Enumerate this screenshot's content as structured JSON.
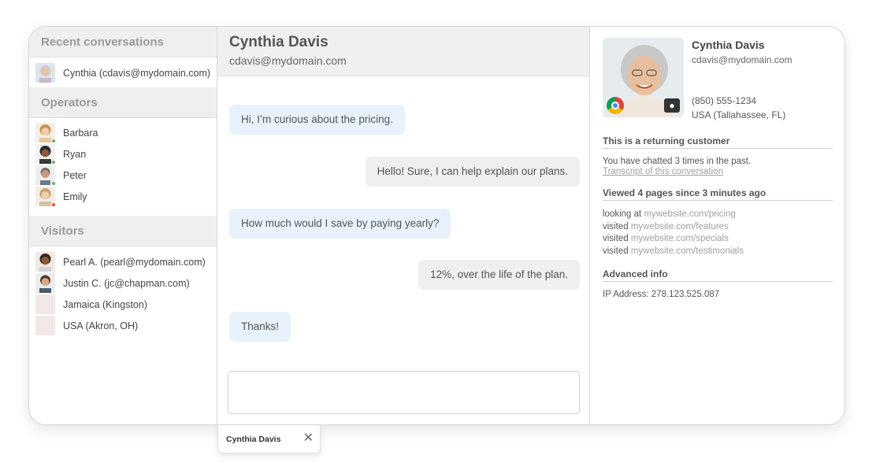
{
  "recent": {
    "header": "Recent conversations",
    "items": [
      {
        "label": "Cynthia (cdavis@mydomain.com)"
      }
    ]
  },
  "operators": {
    "header": "Operators",
    "items": [
      {
        "label": "Barbara",
        "status_color": "#5cb85c"
      },
      {
        "label": "Ryan",
        "status_color": "#5cb85c"
      },
      {
        "label": "Peter",
        "status_color": "#5cb85c"
      },
      {
        "label": "Emily",
        "status_color": "#e74c3c"
      }
    ]
  },
  "visitors": {
    "header": "Visitors",
    "items": [
      {
        "label": "Pearl A. (pearl@mydomain.com)"
      },
      {
        "label": "Justin C. (jc@chapman.com)"
      },
      {
        "label": "Jamaica (Kingston)"
      },
      {
        "label": "USA (Akron, OH)"
      }
    ]
  },
  "chat": {
    "name": "Cynthia Davis",
    "email": "cdavis@mydomain.com",
    "messages": [
      {
        "text": "Hi, I’m curious about the pricing.",
        "direction": "in"
      },
      {
        "text": "Hello! Sure, I can help explain our plans.",
        "direction": "out"
      },
      {
        "text": "How much would I save by paying yearly?",
        "direction": "in"
      },
      {
        "text": "12%, over the life of the plan.",
        "direction": "out"
      },
      {
        "text": "Thanks!",
        "direction": "in"
      }
    ],
    "composer_placeholder": ""
  },
  "profile": {
    "name": "Cynthia Davis",
    "email": "cdavis@mydomain.com",
    "phone": "(850) 555-1234",
    "location": "USA (Tallahassee, FL)",
    "browser_icon": "chrome-icon",
    "os_icon": "apple-icon",
    "returning": {
      "title": "This is a returning customer",
      "text": "You have chatted 3 times in the past.",
      "link": "Transcript of this conversation"
    },
    "pages": {
      "title": "Viewed 4 pages since 3 minutes ago",
      "items": [
        {
          "verb": "looking at",
          "url": "mywebsite.com/pricing"
        },
        {
          "verb": "visited",
          "url": "mywebsite.com/features"
        },
        {
          "verb": "visited",
          "url": "mywebsite.com/specials"
        },
        {
          "verb": "visited",
          "url": "mywebsite.com/testimonials"
        }
      ]
    },
    "advanced": {
      "title": "Advanced info",
      "ip": "IP Address: 278.123.525.087"
    }
  },
  "tab": {
    "label": "Cynthia Davis",
    "close_icon": "close-icon"
  }
}
